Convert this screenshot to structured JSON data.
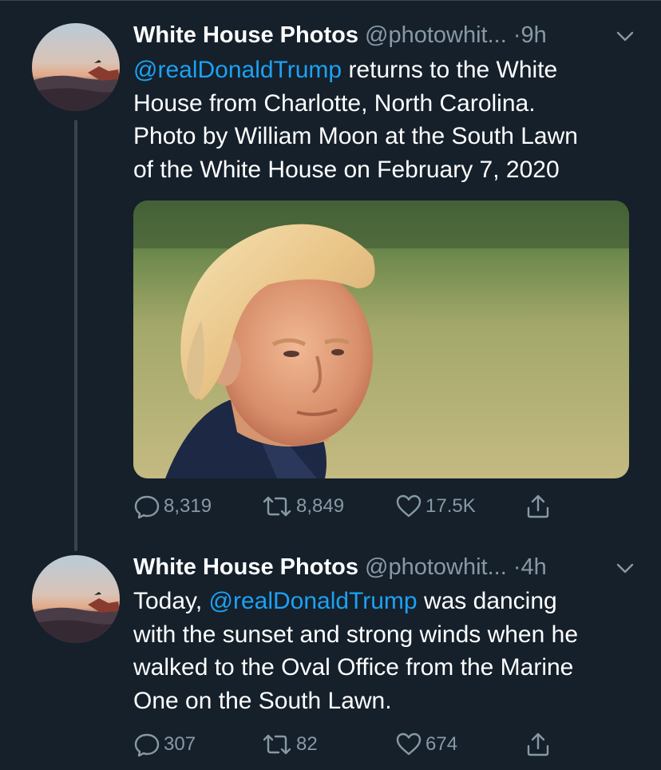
{
  "tweets": [
    {
      "name": "White House Photos",
      "handle": "@photowhit...",
      "dot": "·",
      "time": "9h",
      "lines": [
        {
          "mention": "@realDonaldTrump",
          "text": " returns to the White"
        },
        {
          "text": "House from Charlotte, North Carolina."
        },
        {
          "text": "Photo by William Moon at the South Lawn"
        },
        {
          "text": "of the White House on February 7, 2020"
        }
      ],
      "replies": "8,319",
      "retweets": "8,849",
      "likes": "17.5K"
    },
    {
      "name": "White House Photos",
      "handle": "@photowhit...",
      "dot": "·",
      "time": "4h",
      "lines": [
        {
          "text": "Today, ",
          "mention": "@realDonaldTrump",
          "text2": " was dancing"
        },
        {
          "text": "with the sunset and strong winds when he"
        },
        {
          "text": "walked to the Oval Office from the Marine"
        },
        {
          "text": "One on the South Lawn."
        }
      ],
      "replies": "307",
      "retweets": "82",
      "likes": "674"
    }
  ],
  "icons": {
    "reply": "reply-icon",
    "retweet": "retweet-icon",
    "like": "heart-icon",
    "share": "share-icon",
    "more": "chevron-down-icon"
  },
  "colors": {
    "background": "#15202b",
    "secondary_text": "#8899a6",
    "link": "#1da1f2",
    "divider": "#38444d"
  }
}
